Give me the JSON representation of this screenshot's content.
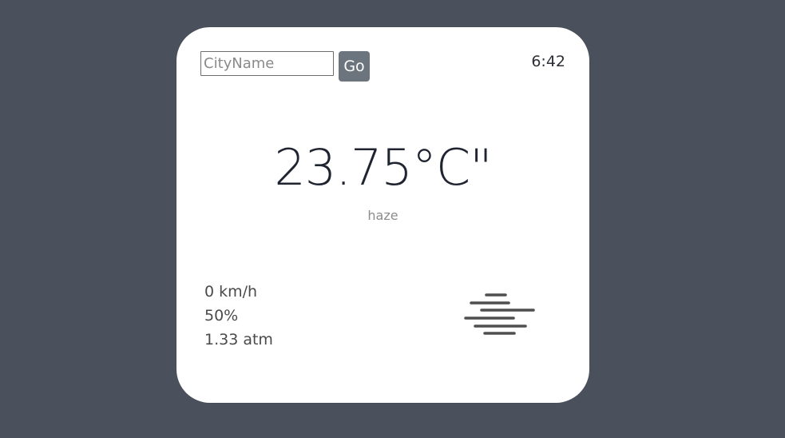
{
  "search": {
    "placeholder": "CityName",
    "value": ""
  },
  "go_button": {
    "label": "Go"
  },
  "clock": {
    "time": "6:42"
  },
  "weather": {
    "temperature": "23.75°C\"",
    "condition": "haze",
    "icon": "haze-icon",
    "wind_speed": "0 km/h",
    "humidity": "50%",
    "pressure": "1.33 atm"
  },
  "colors": {
    "background": "#4a505c",
    "card": "#ffffff",
    "button": "#6c757d"
  }
}
